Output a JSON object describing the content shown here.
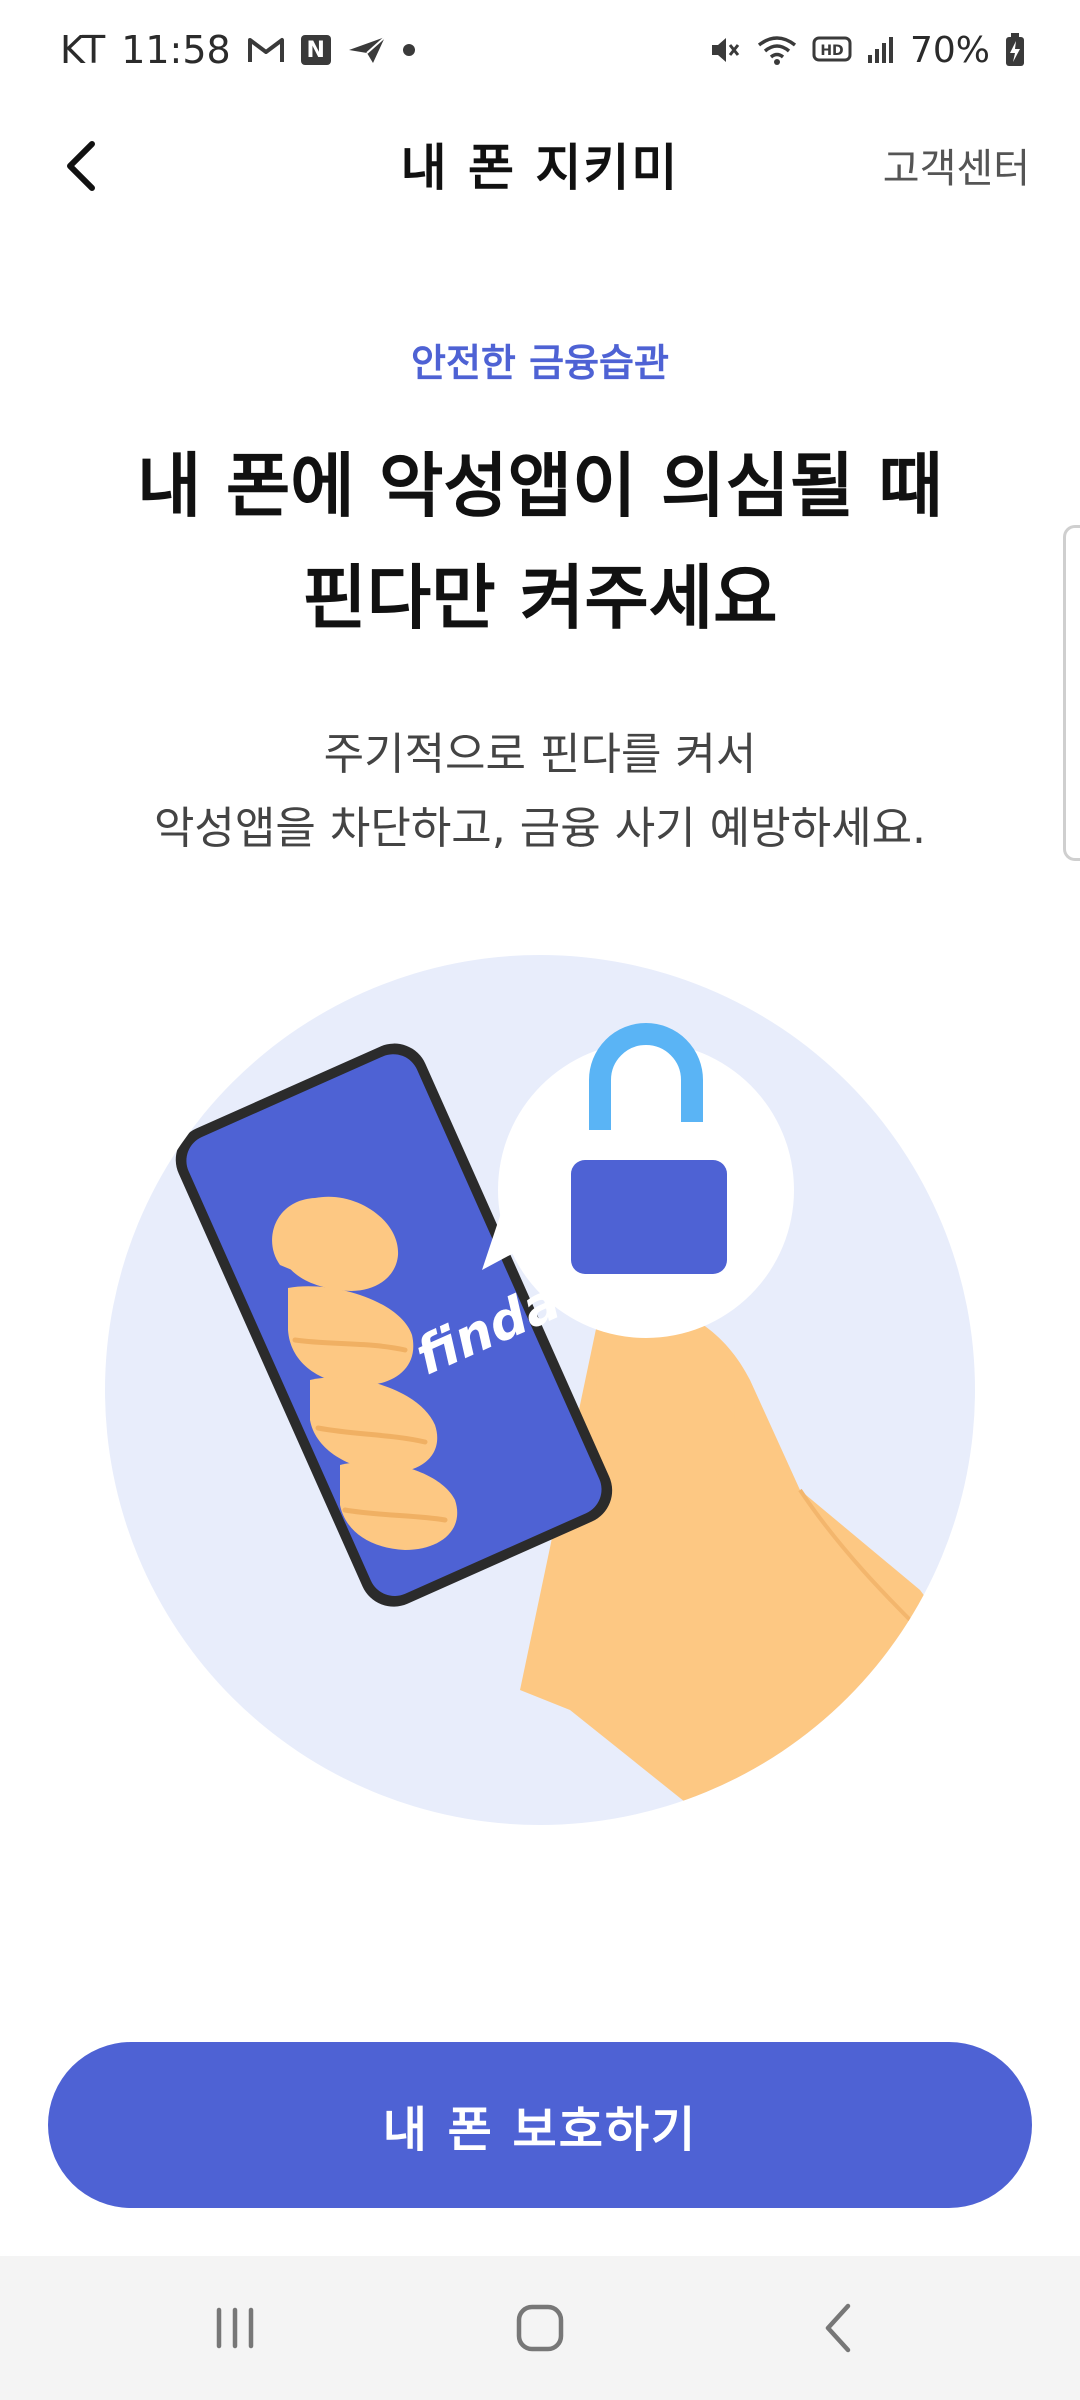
{
  "status_bar": {
    "carrier": "KT",
    "time": "11:58",
    "battery": "70%",
    "left_icons": [
      "gmail-icon",
      "naver-icon",
      "send-icon",
      "dot-icon"
    ],
    "right_icons": [
      "mute-icon",
      "wifi-icon",
      "hd-icon",
      "signal-icon",
      "battery-charging-icon"
    ],
    "naver_badge": "N",
    "hd_label": "HD"
  },
  "header": {
    "title": "내 폰 지키미",
    "right_link": "고객센터",
    "back_icon": "chevron-left-icon"
  },
  "main": {
    "eyebrow": "안전한 금융습관",
    "headline": [
      "내 폰에 악성앱이 의심될 때",
      "핀다만 켜주세요"
    ],
    "description": [
      "주기적으로 핀다를 켜서",
      "악성앱을 차단하고, 금융 사기 예방하세요."
    ],
    "illustration": {
      "phone_brand_text": "finda",
      "icons": [
        "hand-holding-phone",
        "unlocked-padlock-icon"
      ]
    }
  },
  "cta": {
    "label": "내 폰 보호하기"
  },
  "nav_bar": {
    "icons": [
      "recent-apps-icon",
      "home-icon",
      "back-icon"
    ]
  },
  "colors": {
    "accent": "#4e62d4",
    "circle_bg": "#e8edfb",
    "skin": "#fdc883",
    "lock_shackle": "#5ab4f5",
    "text_primary": "#111111",
    "text_secondary": "#444444"
  }
}
